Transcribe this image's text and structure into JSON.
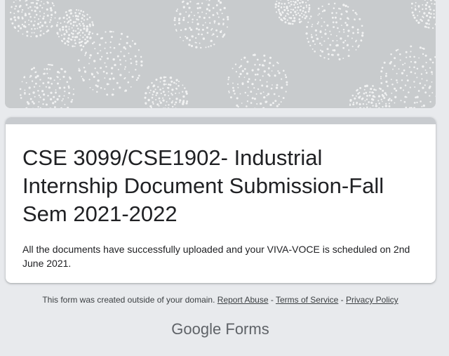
{
  "header": {
    "banner_color": "#c8cbcd",
    "dot_color": "#ffffff"
  },
  "form": {
    "accent_color": "#c8cbcf",
    "title": "CSE 3099/CSE1902- Industrial Internship Document Submission-Fall Sem 2021-2022",
    "confirmation": "All the documents have successfully uploaded and your VIVA-VOCE is scheduled on 2nd June 2021."
  },
  "footer": {
    "notice": "This form was created outside of your domain.",
    "report_abuse": "Report Abuse",
    "terms": "Terms of Service",
    "privacy": "Privacy Policy",
    "separator": " - "
  },
  "branding": {
    "google": "Google",
    "forms": "Forms"
  }
}
